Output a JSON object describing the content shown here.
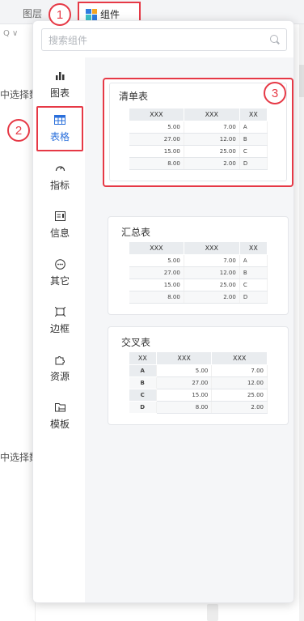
{
  "topbar": {
    "layers_tab": "图层",
    "component_tab": "组件",
    "component_icon": "component-grid-icon"
  },
  "background": {
    "left_text_1": "中选择数",
    "left_text_2": "中选择数",
    "search_glyph": "Q ∨"
  },
  "badges": [
    "1",
    "2",
    "3"
  ],
  "search": {
    "placeholder": "搜索组件"
  },
  "nav": [
    {
      "label": "图表",
      "icon": "chart-bar-icon",
      "glyph": "▂▅▃"
    },
    {
      "label": "表格",
      "icon": "table-icon",
      "glyph": "▦"
    },
    {
      "label": "指标",
      "icon": "gauge-icon",
      "glyph": "◔"
    },
    {
      "label": "信息",
      "icon": "info-card-icon",
      "glyph": "▤"
    },
    {
      "label": "其它",
      "icon": "more-dots-icon",
      "glyph": "⋯"
    },
    {
      "label": "边框",
      "icon": "border-frame-icon",
      "glyph": "⬚"
    },
    {
      "label": "资源",
      "icon": "puzzle-icon",
      "glyph": "✤"
    },
    {
      "label": "模板",
      "icon": "template-folder-icon",
      "glyph": "▭"
    }
  ],
  "active_nav_index": 1,
  "cards": [
    {
      "title": "清单表",
      "headers": [
        "XXX",
        "XXX",
        "XX"
      ],
      "rows": [
        [
          "5.00",
          "7.00",
          "A"
        ],
        [
          "27.00",
          "12.00",
          "B"
        ],
        [
          "15.00",
          "25.00",
          "C"
        ],
        [
          "8.00",
          "2.00",
          "D"
        ]
      ]
    },
    {
      "title": "汇总表",
      "headers": [
        "XXX",
        "XXX",
        "XX"
      ],
      "rows": [
        [
          "5.00",
          "7.00",
          "A"
        ],
        [
          "27.00",
          "12.00",
          "B"
        ],
        [
          "15.00",
          "25.00",
          "C"
        ],
        [
          "8.00",
          "2.00",
          "D"
        ]
      ]
    },
    {
      "title": "交叉表",
      "headers": [
        "XX",
        "XXX",
        "XXX"
      ],
      "rows": [
        [
          "A",
          "5.00",
          "7.00"
        ],
        [
          "B",
          "27.00",
          "12.00"
        ],
        [
          "C",
          "15.00",
          "25.00"
        ],
        [
          "D",
          "8.00",
          "2.00"
        ]
      ]
    }
  ],
  "colors": {
    "accent": "#2a6fdb",
    "highlight": "#e63946",
    "icon_blue": "#2f7de1",
    "icon_orange": "#f5a623",
    "icon_teal": "#3cc1c8"
  }
}
